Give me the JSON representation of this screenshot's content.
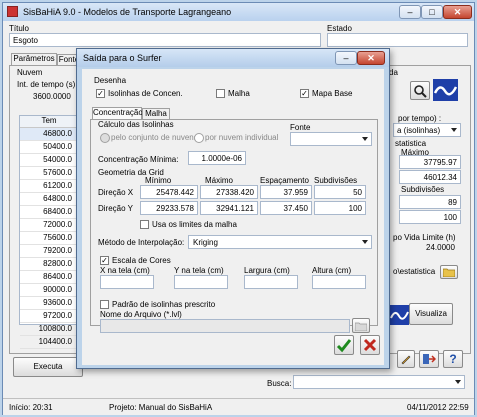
{
  "app": {
    "title": "SisBaHiA 9.0 - Modelos de Transporte Lagrangeano"
  },
  "main": {
    "titulo_label": "Título",
    "titulo_value": "Esgoto",
    "estado_label": "Estado",
    "tabs": [
      "Parâmetros",
      "Fonte"
    ],
    "nuvem_label": "Nuvem",
    "int_tempo_label": "Int. de tempo (s)",
    "int_tempo_value": "3600.0000",
    "grid_header": "Tem",
    "grid_values": [
      "46800.0",
      "50400.0",
      "54000.0",
      "57600.0",
      "61200.0",
      "64800.0",
      "68400.0",
      "72000.0",
      "75600.0",
      "79200.0",
      "82800.0",
      "86400.0",
      "90000.0",
      "93600.0",
      "97200.0",
      "100800.0",
      "104400.0"
    ],
    "right_tab": "da",
    "por_tempo_label": "por tempo) :",
    "isolinhas_combo": "a (isolinhas)",
    "estatistica_label": "statistica",
    "maximo_label": "Máximo",
    "max1": "37795.97",
    "max2": "46012.34",
    "subdivisoes_label": "Subdivisões",
    "sub1": "89",
    "sub2": "100",
    "vida_label": "po Vida Limite (h)",
    "vida_value": "24.0000",
    "estat_label": "o\\estatistica",
    "visualiza_label": "Visualiza",
    "executa_label": "Executa",
    "busca_label": "Busca:",
    "status_inicio": "Início: 20:31",
    "status_projeto": "Projeto: Manual do SisBaHiA",
    "status_data": "04/11/2012 22:59"
  },
  "dialog": {
    "title": "Saída para o Surfer",
    "desenha_label": "Desenha",
    "chk_isolinhas": {
      "label": "Isolinhas de Concen.",
      "checked": true
    },
    "chk_malha": {
      "label": "Malha",
      "checked": false
    },
    "chk_mapa_base": {
      "label": "Mapa Base",
      "checked": true
    },
    "tabs": [
      "Concentração",
      "Malha"
    ],
    "calculo_label": "Cálculo das Isolinhas",
    "radio_conjunto": "pelo conjunto de nuvens",
    "radio_por_nuvem": "por nuvem individual",
    "fonte_label": "Fonte",
    "conc_min_label": "Concentração Mínima:",
    "conc_min_value": "1.0000e-06",
    "geom_label": "Geometria da Grid",
    "col_minimo": "Mínimo",
    "col_maximo": "Máximo",
    "col_espacamento": "Espaçamento",
    "col_subdivisoes": "Subdivisões",
    "dir_x_label": "Direção X",
    "dir_x": [
      "25478.442",
      "27338.420",
      "37.959",
      "50"
    ],
    "dir_y_label": "Direção Y",
    "dir_y": [
      "29233.578",
      "32941.121",
      "37.450",
      "100"
    ],
    "chk_limites": {
      "label": "Usa os limites da malha",
      "checked": false
    },
    "metodo_label": "Método de Interpolação:",
    "metodo_value": "Kriging",
    "chk_escala": {
      "label": "Escala de Cores",
      "checked": true
    },
    "x_tela_label": "X na tela (cm)",
    "y_tela_label": "Y na tela (cm)",
    "largura_label": "Largura (cm)",
    "altura_label": "Altura (cm)",
    "chk_padrao": {
      "label": "Padrão de isolinhas prescrito",
      "checked": false
    },
    "nome_arquivo_label": "Nome do Arquivo (*.lvl)"
  },
  "colors": {
    "accent": "#2a5fb0",
    "ok_green": "#1e8a1e",
    "cancel_red": "#c0281e"
  }
}
